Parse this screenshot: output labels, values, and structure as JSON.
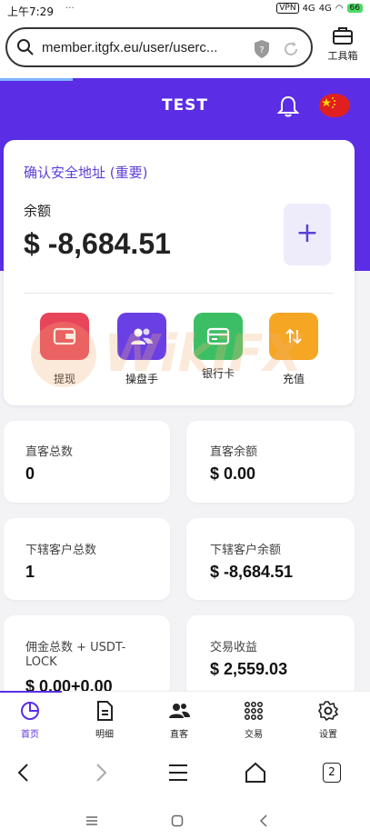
{
  "status_bar": {
    "time": "上午7:29",
    "dots": "···",
    "vpn": "VPN",
    "signal1": "4G",
    "signal2": "4G",
    "battery": "66"
  },
  "browser": {
    "url": "member.itgfx.eu/user/userc...",
    "toolbox_label": "工具箱",
    "tabs_count": "2"
  },
  "header": {
    "title": "TEST"
  },
  "account": {
    "confirm_link": "确认安全地址 (重要)",
    "balance_label": "余额",
    "balance_value": "$ -8,684.51",
    "plus": "+"
  },
  "actions": [
    {
      "label": "提现",
      "color": "#e8445a"
    },
    {
      "label": "操盘手",
      "color": "#6a3fe3"
    },
    {
      "label": "银行卡",
      "color": "#3cbf64"
    },
    {
      "label": "充值",
      "color": "#f5a623"
    }
  ],
  "stats": [
    {
      "label": "直客总数",
      "value": "0"
    },
    {
      "label": "直客余额",
      "value": "$ 0.00"
    },
    {
      "label": "下辖客户总数",
      "value": "1"
    },
    {
      "label": "下辖客户余额",
      "value": "$ -8,684.51"
    },
    {
      "label_line1": "佣金总数 + USDT-",
      "label_line2": "LOCK",
      "value": "$ 0.00+0.00"
    },
    {
      "label": "交易收益",
      "value": "$ 2,559.03"
    }
  ],
  "bottom_nav": [
    {
      "label": "首页",
      "icon": "pie-chart-icon"
    },
    {
      "label": "明细",
      "icon": "document-icon"
    },
    {
      "label": "直客",
      "icon": "users-icon"
    },
    {
      "label": "交易",
      "icon": "grid-dots-icon"
    },
    {
      "label": "设置",
      "icon": "gear-icon"
    }
  ],
  "watermark": "WikiFX",
  "colors": {
    "primary": "#5b2ee6",
    "link": "#5b3fd6",
    "flag_red": "#e02020"
  }
}
